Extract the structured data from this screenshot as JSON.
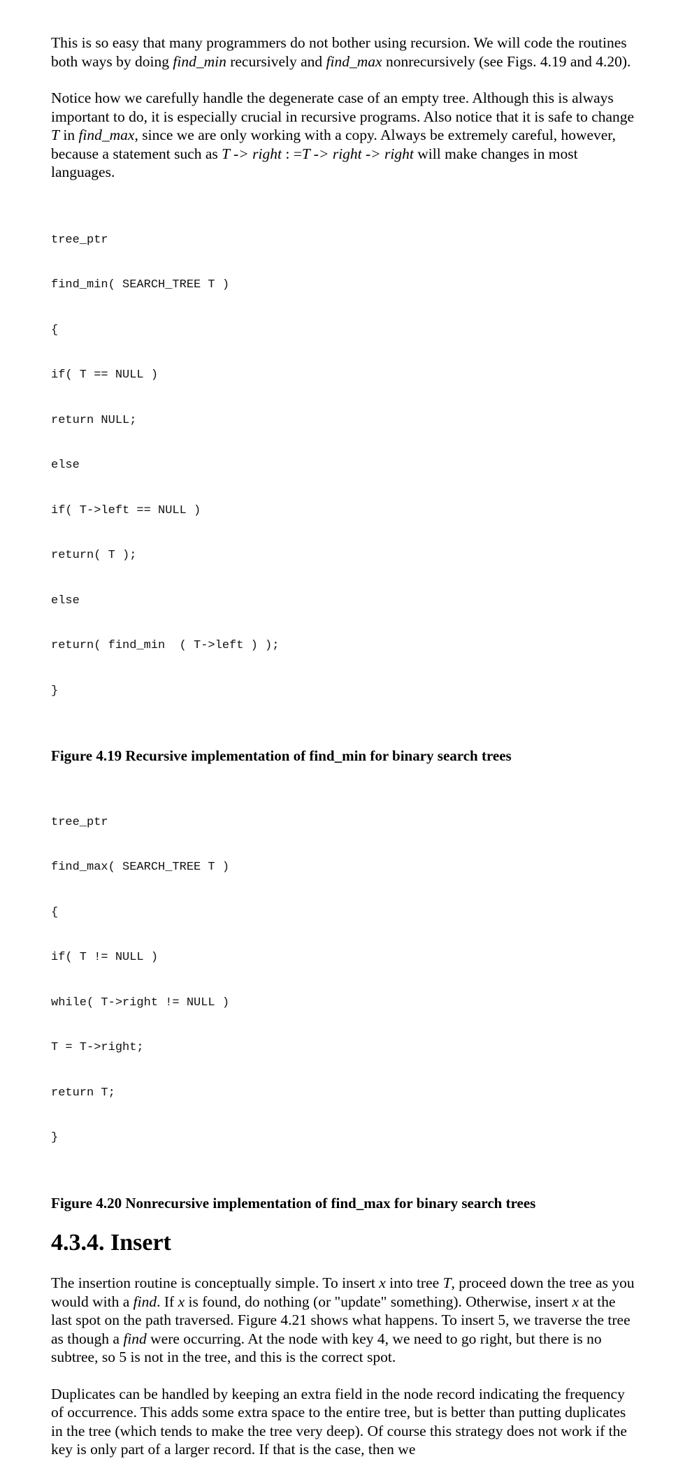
{
  "para1": {
    "t1": "This is so easy that many programmers do not bother using recursion. We will code the routines both ways by doing ",
    "i1": "find_min",
    "t2": " recursively and ",
    "i2": "find_max",
    "t3": " nonrecursively (see Figs. 4.19 and 4.20)."
  },
  "para2": {
    "t1": "Notice how we carefully handle the degenerate case of an empty tree. Although this is always important to do, it is especially crucial in recursive programs. Also notice that it is safe to change ",
    "i1": "T",
    "t2": " in ",
    "i2": "find_max",
    "t3": ", since we are only working with a copy. Always be extremely careful, however, because a statement such as ",
    "i3": "T -> right",
    "t4": " : =",
    "i4": "T -> right -> right",
    "t5": " will make changes in most languages."
  },
  "code1": [
    "tree_ptr",
    "find_min( SEARCH_TREE T )",
    "{",
    "if( T == NULL )",
    "return NULL;",
    "else",
    "if( T->left == NULL )",
    "return( T );",
    "else",
    "return( find_min  ( T->left ) );",
    "}"
  ],
  "caption1": "Figure 4.19 Recursive implementation of find_min for binary search trees",
  "code2": [
    "tree_ptr",
    "find_max( SEARCH_TREE T )",
    "{",
    "if( T != NULL )",
    "while( T->right != NULL )",
    "T = T->right;",
    "return T;",
    "}"
  ],
  "caption2": "Figure 4.20 Nonrecursive implementation of find_max for binary search trees",
  "heading": "4.3.4. Insert",
  "para3": {
    "t1": "The insertion routine is conceptually simple. To insert ",
    "i1": "x",
    "t2": " into tree ",
    "i2": "T",
    "t3": ", proceed down the tree as you would with a ",
    "i3": "find",
    "t4": ". If ",
    "i4": "x",
    "t5": " is found, do nothing (or \"update\" something). Otherwise, insert ",
    "i5": "x",
    "t6": " at the last spot on the path traversed. Figure 4.21 shows what happens. To insert 5, we traverse the tree as though a ",
    "i6": "find",
    "t7": " were occurring. At the node with key 4, we need to go right, but there is no subtree, so 5 is not in the tree, and this is the correct spot."
  },
  "para4": "Duplicates can be handled by keeping an extra field in the node record indicating the frequency of occurrence. This adds some extra space to the entire tree, but is better than putting duplicates in the tree (which tends to make the tree very deep). Of course this strategy does not work if the key is only part of a larger record. If that is the case, then we"
}
